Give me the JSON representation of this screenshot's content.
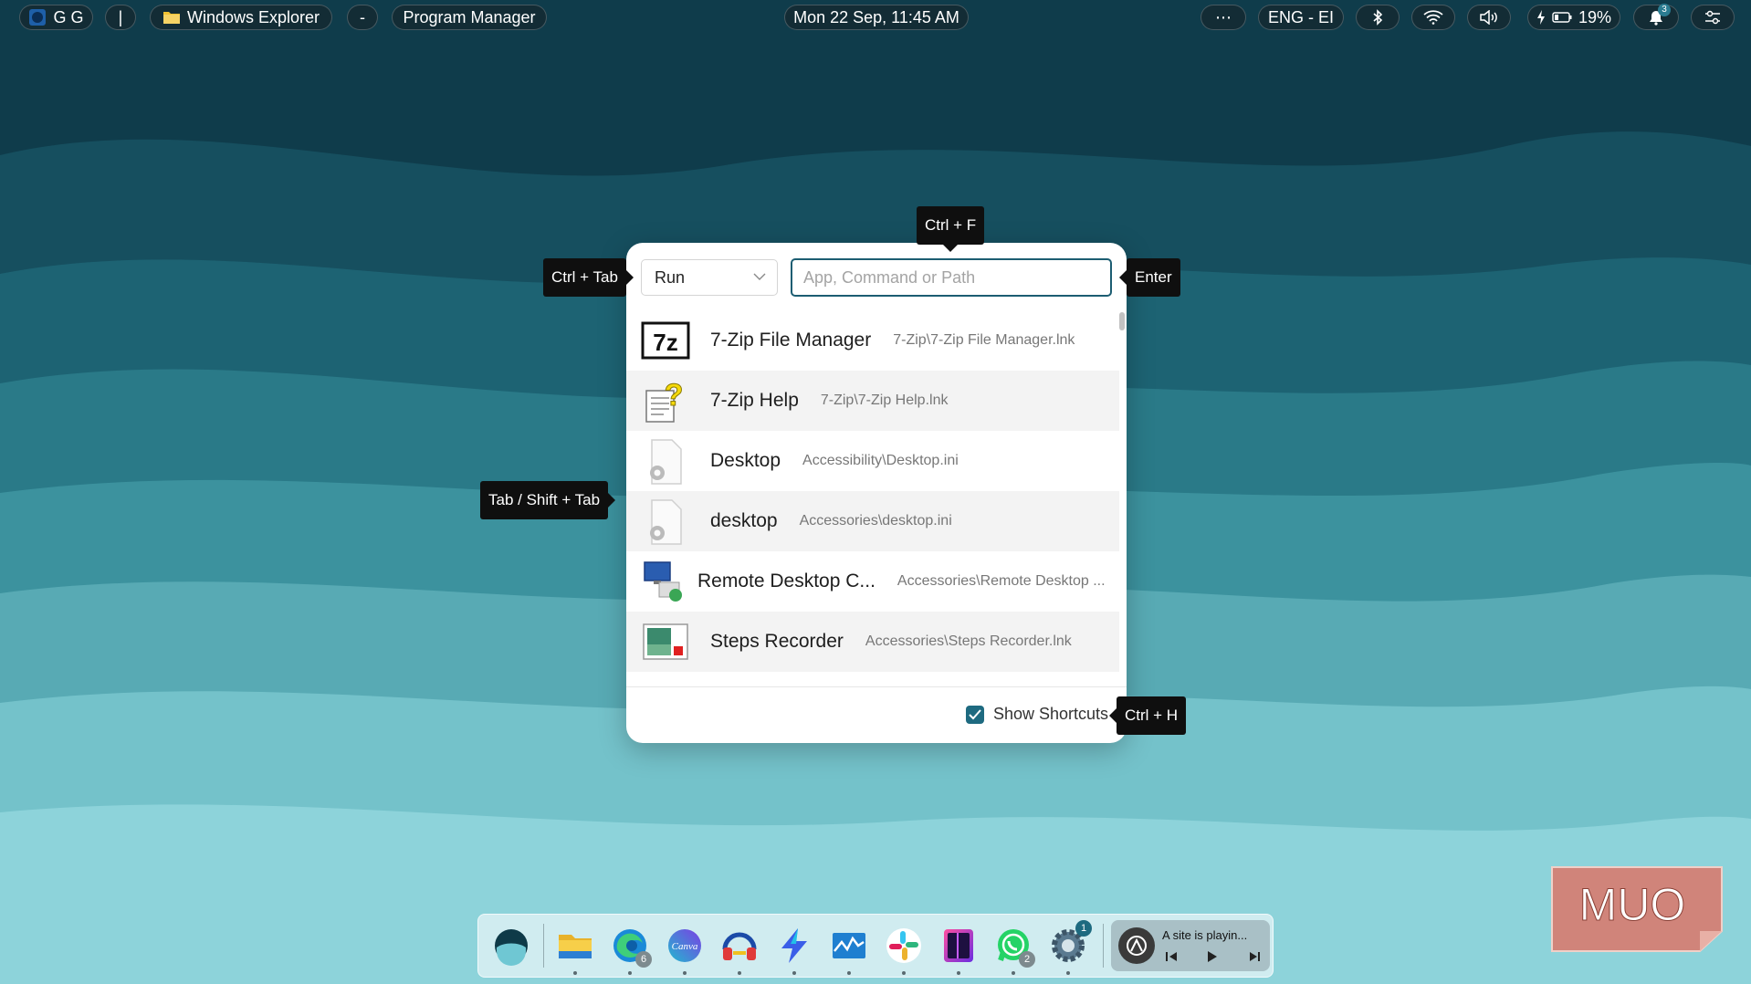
{
  "topbar": {
    "workspace_label": "G G",
    "separator": "|",
    "explorer_label": "Windows Explorer",
    "dash": "-",
    "program_manager_label": "Program Manager",
    "datetime": "Mon 22 Sep, 11:45 AM",
    "more": "⋯",
    "language": "ENG - EI",
    "battery_percent": "19%",
    "notification_count": "3"
  },
  "dialog": {
    "mode_selected": "Run",
    "search_placeholder": "App, Command or Path",
    "results": [
      {
        "name": "7-Zip File Manager",
        "path": "7-Zip\\7-Zip File Manager.lnk",
        "icon": "7zip-icon"
      },
      {
        "name": "7-Zip Help",
        "path": "7-Zip\\7-Zip Help.lnk",
        "icon": "help-file-icon"
      },
      {
        "name": "Desktop",
        "path": "Accessibility\\Desktop.ini",
        "icon": "settings-file-icon"
      },
      {
        "name": "desktop",
        "path": "Accessories\\desktop.ini",
        "icon": "settings-file-icon"
      },
      {
        "name": "Remote Desktop C...",
        "path": "Accessories\\Remote Desktop ...",
        "icon": "remote-desktop-icon"
      },
      {
        "name": "Steps Recorder",
        "path": "Accessories\\Steps Recorder.lnk",
        "icon": "steps-recorder-icon"
      }
    ],
    "show_shortcuts_label": "Show Shortcuts",
    "show_shortcuts_checked": true
  },
  "tooltips": {
    "mode": "Ctrl + Tab",
    "search": "Ctrl + F",
    "submit": "Enter",
    "navigate": "Tab / Shift + Tab",
    "shortcuts": "Ctrl + H"
  },
  "dock": {
    "items": [
      "seelen-icon",
      "file-explorer-icon",
      "edge-icon",
      "canva-icon",
      "headphones-app-icon",
      "lightning-app-icon",
      "task-manager-icon",
      "slack-icon",
      "notes-app-icon",
      "whatsapp-icon",
      "settings-icon"
    ],
    "edge_badge": "6",
    "whatsapp_badge": "2",
    "settings_badge": "1",
    "media_title": "A site is playin..."
  },
  "watermark": "MUO",
  "colors": {
    "accent": "#1c5d72",
    "tooltip_bg": "#0f0f0f",
    "checkbox": "#1e6a80"
  }
}
